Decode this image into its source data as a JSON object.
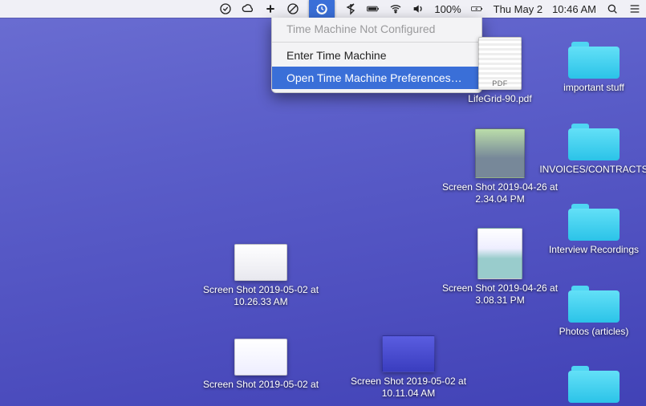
{
  "menubar": {
    "battery_pct": "100%",
    "date": "Thu May 2",
    "time": "10:46 AM"
  },
  "dropdown": {
    "status": "Time Machine Not Configured",
    "enter": "Enter Time Machine",
    "prefs": "Open Time Machine Preferences…"
  },
  "icons": {
    "lifegrid": "LifeGrid-90.pdf",
    "pdf_badge": "PDF",
    "important": "important stuff",
    "invoices": "INVOICES/CONTRACTS",
    "interview": "Interview Recordings",
    "photos": "Photos (articles)",
    "ss1": "Screen Shot 2019-04-26 at 2.34.04 PM",
    "ss2": "Screen Shot 2019-04-26 at 3.08.31 PM",
    "ss3": "Screen Shot 2019-05-02 at 10.26.33 AM",
    "ss4": "Screen Shot 2019-05-02 at 10.11.04 AM",
    "ss5": "Screen Shot 2019-05-02 at"
  }
}
